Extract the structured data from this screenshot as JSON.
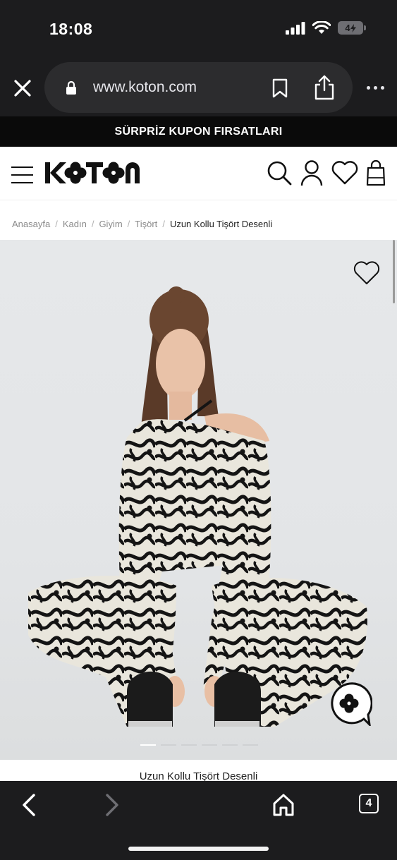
{
  "status_bar": {
    "time": "18:08",
    "battery": "4"
  },
  "browser": {
    "url": "www.koton.com",
    "tab_count": "4"
  },
  "promo": {
    "text": "SÜRPRİZ KUPON FIRSATLARI"
  },
  "brand": {
    "name": "KOTON"
  },
  "breadcrumb": {
    "items": [
      "Anasayfa",
      "Kadın",
      "Giyim",
      "Tişört"
    ],
    "current": "Uzun Kollu Tişört Desenli",
    "separator": "/"
  },
  "product": {
    "title": "Uzun Kollu Tişört Desenli",
    "image_count": 6,
    "active_image": 1
  },
  "colors": {
    "chrome_bg": "#1c1c1e",
    "promo_bg": "#0a0a0a",
    "accent": "#111111"
  },
  "icons": {
    "header": [
      "menu-icon",
      "search-icon",
      "account-icon",
      "wishlist-icon",
      "cart-icon"
    ],
    "browser": [
      "close-icon",
      "lock-icon",
      "bookmark-icon",
      "share-icon",
      "more-icon"
    ],
    "bottom": [
      "back-icon",
      "forward-icon",
      "home-icon",
      "tabs-icon"
    ]
  }
}
